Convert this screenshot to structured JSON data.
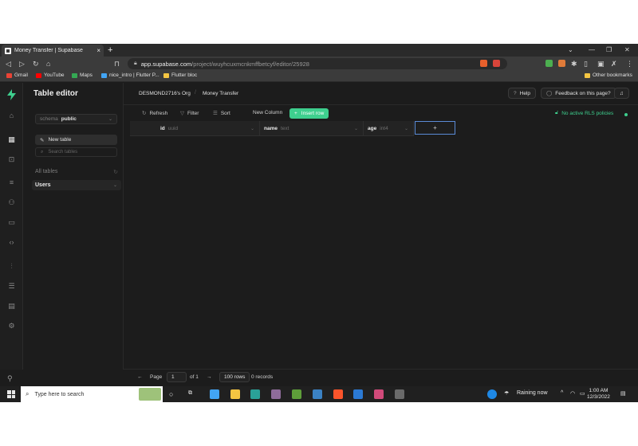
{
  "browser": {
    "tab_title": "Money Transfer | Supabase",
    "tab_close": "×",
    "new_tab": "+",
    "url_host": "app.supabase.com",
    "url_path": "/project/wuyhcuxmcnkmffbetcyf/editor/25928",
    "bookmarks": [
      {
        "label": "Gmail",
        "color": "#ea4335"
      },
      {
        "label": "YouTube",
        "color": "#ff0000"
      },
      {
        "label": "Maps",
        "color": "#34a853"
      },
      {
        "label": "nice_intro | Flutter P...",
        "color": "#42a5f5"
      },
      {
        "label": "Flutter bloc",
        "color": "#f4c542"
      }
    ],
    "other_bookmarks": "Other bookmarks"
  },
  "sidebar": {
    "title": "Table editor",
    "schema_label": "schema",
    "schema_value": "public",
    "new_table": "New table",
    "search_placeholder": "Search tables",
    "all_tables": "All tables",
    "tables": [
      "Users"
    ]
  },
  "topbar": {
    "org": "DESMOND2716's Org",
    "project": "Money Transfer",
    "help": "Help",
    "feedback": "Feedback on this page?"
  },
  "toolbar": {
    "refresh": "Refresh",
    "filter": "Filter",
    "sort": "Sort",
    "new_column": "New Column",
    "insert_row": "Insert row",
    "rls": "No active RLS policies"
  },
  "grid": {
    "columns": [
      {
        "name": "id",
        "type": "uuid"
      },
      {
        "name": "name",
        "type": "text"
      },
      {
        "name": "age",
        "type": "int4"
      }
    ],
    "add_column": "+"
  },
  "footer": {
    "page_label": "Page",
    "page_value": "1",
    "of_label": "of 1",
    "rows_label": "100 rows",
    "records": "0 records"
  },
  "taskbar": {
    "search_placeholder": "Type here to search",
    "weather": "Raining now",
    "time": "1:00 AM",
    "date": "12/3/2022"
  },
  "colors": {
    "accent": "#3ecf8e",
    "background": "#1c1c1c",
    "selection": "#5b8bd6"
  }
}
